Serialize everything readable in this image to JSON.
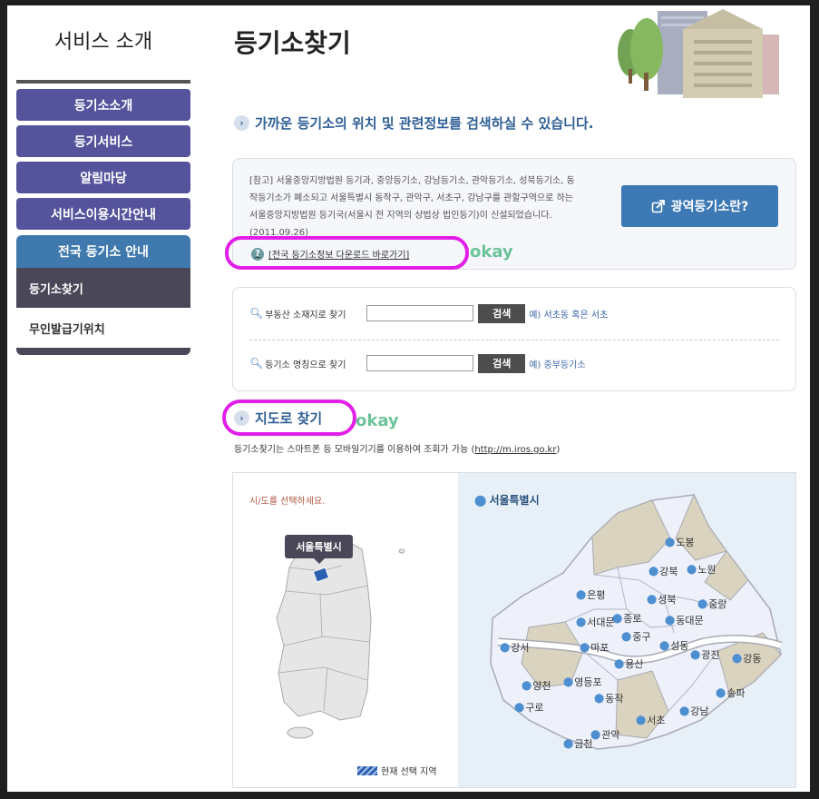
{
  "sidebar": {
    "title": "서비스 소개",
    "items": [
      "등기소소개",
      "등기서비스",
      "알림마당",
      "서비스이용시간안내"
    ],
    "active": "전국 등기소 안내",
    "sub_active": "등기소찾기",
    "sub_other": "무인발급기위치"
  },
  "page": {
    "title": "등기소찾기",
    "intro": "가까운 등기소의 위치 및 관련정보를 검색하실 수 있습니다."
  },
  "notice": {
    "text": "[참고] 서울중앙지방법원 등기과, 중앙등기소, 강남등기소, 관악등기소, 성북등기소, 동작등기소가 폐소되고 서울특별시 동작구, 관악구, 서초구, 강남구를 관할구역으로 하는 서울중앙지방법원 등기국(서울시 전 지역의 상법상 법인등기)이 신설되었습니다. (2011.09.26)",
    "link": "[전국 등기소정보 다운로드 바로가기]",
    "wide_button": "광역등기소란?"
  },
  "annotation": {
    "okay": "okay"
  },
  "search": {
    "row1_label": "부동산 소재지로 찾기",
    "row1_hint": "예) 서초동 혹은 서초",
    "row2_label": "등기소 명칭으로 찾기",
    "row2_hint": "예) 중부등기소",
    "button": "검색"
  },
  "map": {
    "title": "지도로 찾기",
    "desc_prefix": "등기소찾기는 스마트폰 등 모바일기기를 이용하여 조회가 가능 (",
    "desc_link": "http://m.iros.go.kr",
    "desc_suffix": ")",
    "select_prompt": "시/도를 선택하세요.",
    "selected": "서울특별시",
    "legend": "현재 선택 지역",
    "region_title": "서울특별시",
    "districts": [
      "도봉",
      "강북",
      "노원",
      "은평",
      "성북",
      "중랑",
      "종로",
      "서대문",
      "동대문",
      "중구",
      "마포",
      "성동",
      "용산",
      "광진",
      "강동",
      "강서",
      "양천",
      "영등포",
      "동작",
      "송파",
      "구로",
      "서초",
      "강남",
      "관악",
      "금천"
    ]
  },
  "colors": {
    "nav": "#55539b",
    "active": "#3f79ae",
    "highlight": "#e21ee8",
    "okay": "#6cc39a"
  }
}
